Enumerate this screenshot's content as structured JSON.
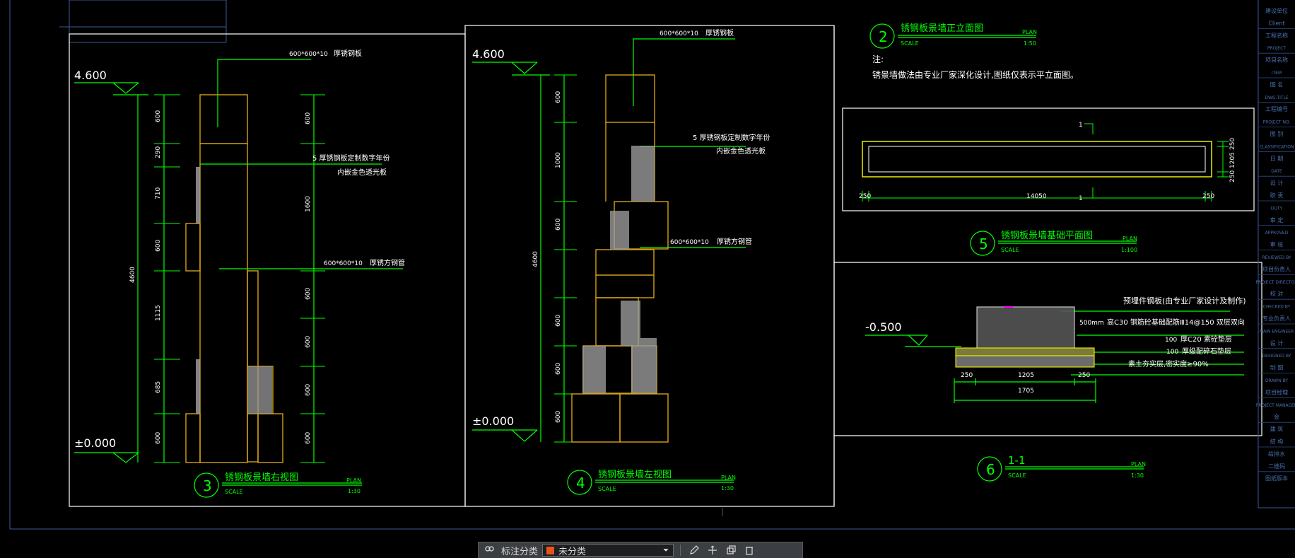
{
  "colors": {
    "background": "#000000",
    "green_text": "#00ff00",
    "white_text": "#ffffff",
    "drawing_orange": "#d4a017",
    "accent_swatch": "#e8521e"
  },
  "drawing_3": {
    "number": "3",
    "title": "锈钢板景墙右视图",
    "plan": "PLAN",
    "scale": "SCALE",
    "ratio": "1:30",
    "level_top": "4.600",
    "level_bottom": "±0.000",
    "total_dim": "4600",
    "dims_left": [
      "600",
      "290",
      "710",
      "600",
      "1115",
      "685",
      "600"
    ],
    "dims_right": [
      "600",
      "1600",
      "600",
      "600",
      "600",
      "600"
    ],
    "callout_steel_plate_size": "600*600*10",
    "callout_steel_plate": "厚锈钢板",
    "callout_number_line1": "5 厚锈钢板定制数字年份",
    "callout_number_line2": "内嵌金色透光板",
    "callout_tube_size": "600*600*10",
    "callout_tube": "厚锈方钢管"
  },
  "drawing_4": {
    "number": "4",
    "title": "锈钢板景墙左视图",
    "plan": "PLAN",
    "scale": "SCALE",
    "ratio": "1:30",
    "level_top": "4.600",
    "level_bottom": "±0.000",
    "total_dim": "4600",
    "dims_left": [
      "600",
      "1000",
      "600",
      "600",
      "600",
      "600"
    ],
    "callout_steel_plate_size": "600*600*10",
    "callout_steel_plate": "厚锈钢板",
    "callout_number_line1": "5 厚锈钢板定制数字年份",
    "callout_number_line2": "内嵌金色透光板",
    "callout_tube_size": "600*600*10",
    "callout_tube": "厚锈方钢管"
  },
  "drawing_2": {
    "number": "2",
    "title": "锈钢板景墙正立面图",
    "plan": "PLAN",
    "scale": "SCALE",
    "ratio": "1:50",
    "note_label": "注:",
    "note_text": "锈景墙做法由专业厂家深化设计,图纸仅表示平立面图。"
  },
  "drawing_5": {
    "number": "5",
    "title": "锈钢板景墙基础平面图",
    "plan": "PLAN",
    "scale": "SCALE",
    "ratio": "1:100",
    "dim_total": "14050",
    "dim_left": "250",
    "dim_right": "250",
    "dim_h1": "250",
    "dim_h2": "1205",
    "dim_h3": "250",
    "mark_top": "1",
    "mark_bottom": "1"
  },
  "drawing_6": {
    "number": "6",
    "title": "1-1",
    "plan": "PLAN",
    "scale": "SCALE",
    "ratio": "1:30",
    "level": "-0.500",
    "note_top": "预埋件钢板(由专业厂家设计及制作)",
    "note_500": "500mm",
    "note_concrete": "高C30 钢筋砼基础配筋Ⅲ14@150 双层双向",
    "note_c20_num": "100",
    "note_c20": "厚C20 素砼垫层",
    "note_gravel_num": "100",
    "note_gravel": "厚级配碎石垫层",
    "note_soil": "素土夯实层,密实度≥90%",
    "dim_a": "250",
    "dim_b": "1205",
    "dim_c": "250",
    "dim_total": "1705"
  },
  "title_block": {
    "rows": [
      "建设单位",
      "CIient",
      "工程名称",
      "PROJECT",
      "项目名称",
      "ITEM",
      "图 名",
      "DWG.TITLE",
      "工程编号",
      "PROJECT NO.",
      "图 别",
      "CLASSIFICATION",
      "日 期",
      "DATE",
      "设 计",
      "职 责",
      "DUTY",
      "审 定",
      "APPROVED",
      "审 核",
      "REVIEWED BY",
      "项目负责人",
      "PROJECT DIRECTOR",
      "校 对",
      "CHECKED BY",
      "专业负责人",
      "MAIN ENGINEER",
      "设 计",
      "DESIGNED BY",
      "制 图",
      "DRAWN BY",
      "项目经理",
      "PROJECT MANAGER",
      "会",
      "建 筑",
      "结 构",
      "给排水",
      "二维码",
      "图纸版本"
    ]
  },
  "toolbar": {
    "label": "标注分类",
    "select_value": "未分类",
    "icons": [
      "layers-icon",
      "dropdown-chevron-icon",
      "pen-icon",
      "move-icon",
      "copy-icon",
      "erase-icon"
    ]
  }
}
